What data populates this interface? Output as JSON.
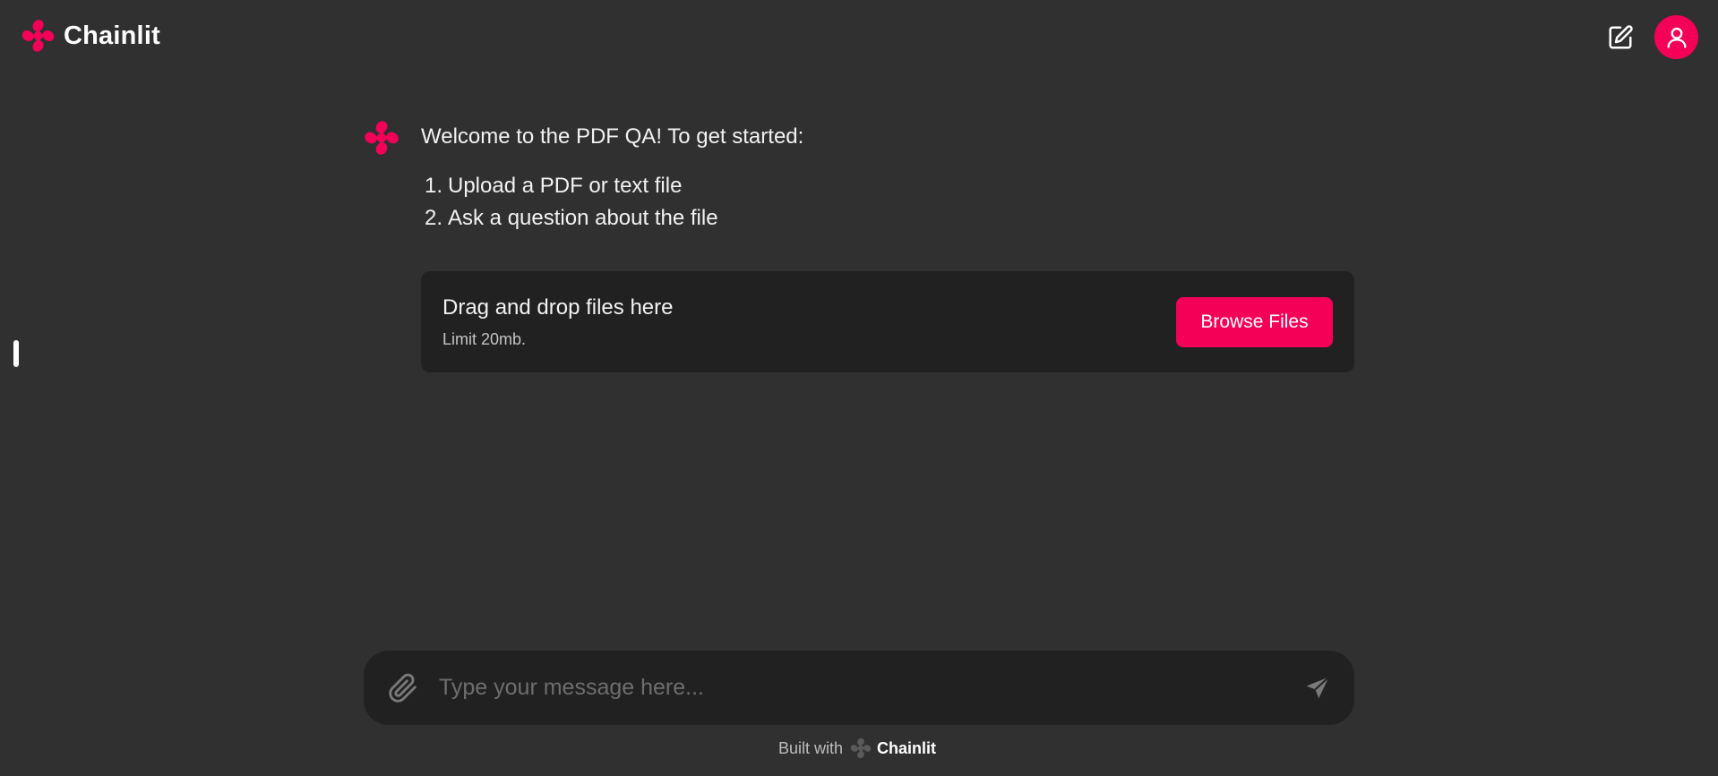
{
  "app": {
    "brand_name": "Chainlit",
    "accent_color": "#f50057",
    "background_color": "#303030",
    "panel_color": "#212121"
  },
  "header": {
    "logo_icon": "chainlit-logo-icon",
    "new_chat_icon": "edit-icon",
    "user_icon": "user-icon"
  },
  "message": {
    "avatar_icon": "chainlit-logo-icon",
    "title": "Welcome to the PDF QA! To get started:",
    "steps": [
      {
        "num": "1.",
        "text": "Upload a PDF or text file"
      },
      {
        "num": "2.",
        "text": "Ask a question about the file"
      }
    ]
  },
  "upload": {
    "title": "Drag and drop files here",
    "limit": "Limit 20mb.",
    "browse_label": "Browse Files"
  },
  "composer": {
    "placeholder": "Type your message here...",
    "value": "",
    "attach_icon": "paperclip-icon",
    "send_icon": "send-icon"
  },
  "footer": {
    "built_with": "Built with",
    "brand": "Chainlit"
  }
}
